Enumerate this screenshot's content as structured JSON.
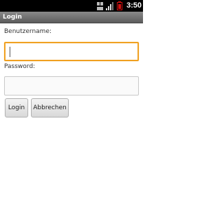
{
  "status_bar": {
    "time": "3:50",
    "icons": [
      "usb-debugging-icon",
      "signal-icon",
      "battery-icon"
    ]
  },
  "title_bar": {
    "title": "Login"
  },
  "form": {
    "username_label": "Benutzername:",
    "username_value": "",
    "password_label": "Password:",
    "password_value": ""
  },
  "buttons": {
    "login": "Login",
    "cancel": "Abbrechen"
  },
  "colors": {
    "focus_border": "#f0a020",
    "title_bar": "#707070",
    "battery": "#d01010"
  }
}
